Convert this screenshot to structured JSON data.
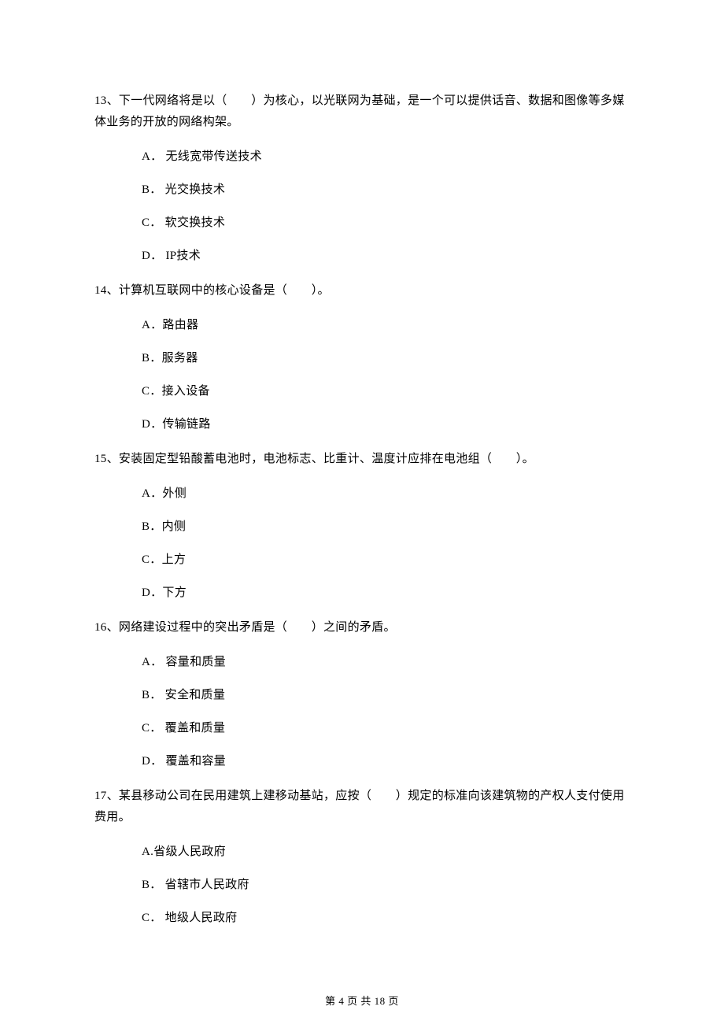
{
  "questions": [
    {
      "text": "13、下一代网络将是以（　　）为核心，以光联网为基础，是一个可以提供话音、数据和图像等多媒体业务的开放的网络构架。",
      "options": [
        "A． 无线宽带传送技术",
        "B． 光交换技术",
        "C． 软交换技术",
        "D． IP技术"
      ]
    },
    {
      "text": "14、计算机互联网中的核心设备是（　　）。",
      "options": [
        "A．路由器",
        "B．服务器",
        "C．接入设备",
        "D．传输链路"
      ]
    },
    {
      "text": "15、安装固定型铅酸蓄电池时，电池标志、比重计、温度计应排在电池组（　　）。",
      "options": [
        "A．外侧",
        "B．内侧",
        "C．上方",
        "D．下方"
      ]
    },
    {
      "text": "16、网络建设过程中的突出矛盾是（　　）之间的矛盾。",
      "options": [
        "A． 容量和质量",
        "B． 安全和质量",
        "C． 覆盖和质量",
        "D． 覆盖和容量"
      ]
    },
    {
      "text": "17、某县移动公司在民用建筑上建移动基站，应按（　　）规定的标准向该建筑物的产权人支付使用费用。",
      "options": [
        "A.省级人民政府",
        "B． 省辖市人民政府",
        "C． 地级人民政府"
      ]
    }
  ],
  "footer": "第 4 页 共 18 页"
}
